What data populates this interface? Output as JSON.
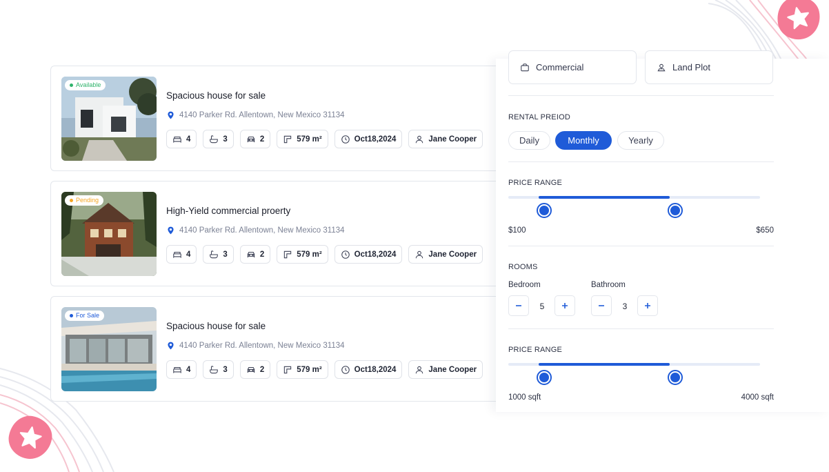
{
  "colors": {
    "accent": "#1f5bd8",
    "available": "#2fb36b",
    "pending": "#f5a623",
    "for_sale": "#1f5bd8",
    "decor_pink": "#f47a95"
  },
  "listings": [
    {
      "badge": "Available",
      "title": "Spacious house for sale",
      "address": "4140 Parker Rd. Allentown, New Mexico 31134",
      "beds": "4",
      "baths": "3",
      "garage": "2",
      "area": "579 m²",
      "date": "Oct18,2024",
      "agent": "Jane Cooper"
    },
    {
      "badge": "Pending",
      "title": "High-Yield commercial proerty",
      "address": "4140 Parker Rd. Allentown, New Mexico 31134",
      "beds": "4",
      "baths": "3",
      "garage": "2",
      "area": "579 m²",
      "date": "Oct18,2024",
      "agent": "Jane Cooper"
    },
    {
      "badge": "For Sale",
      "title": "Spacious house for sale",
      "address": "4140 Parker Rd. Allentown, New Mexico 31134",
      "beds": "4",
      "baths": "3",
      "garage": "2",
      "area": "579 m²",
      "date": "Oct18,2024",
      "agent": "Jane Cooper"
    }
  ],
  "filters": {
    "property_types": [
      "Commercial",
      "Land Plot"
    ],
    "rental_period": {
      "label": "RENTAL PREIOD",
      "options": [
        "Daily",
        "Monthly",
        "Yearly"
      ],
      "selected": "Monthly"
    },
    "price_range": {
      "label": "PRICE RANGE",
      "min_label": "$100",
      "max_label": "$650",
      "low_fraction": 0.12,
      "high_fraction": 0.64
    },
    "rooms": {
      "label": "ROOMS",
      "bedroom_label": "Bedroom",
      "bedroom_value": "5",
      "bathroom_label": "Bathroom",
      "bathroom_value": "3"
    },
    "area_range": {
      "label": "PRICE RANGE",
      "min_label": "1000 sqft",
      "max_label": "4000 sqft",
      "low_fraction": 0.12,
      "high_fraction": 0.64
    }
  }
}
